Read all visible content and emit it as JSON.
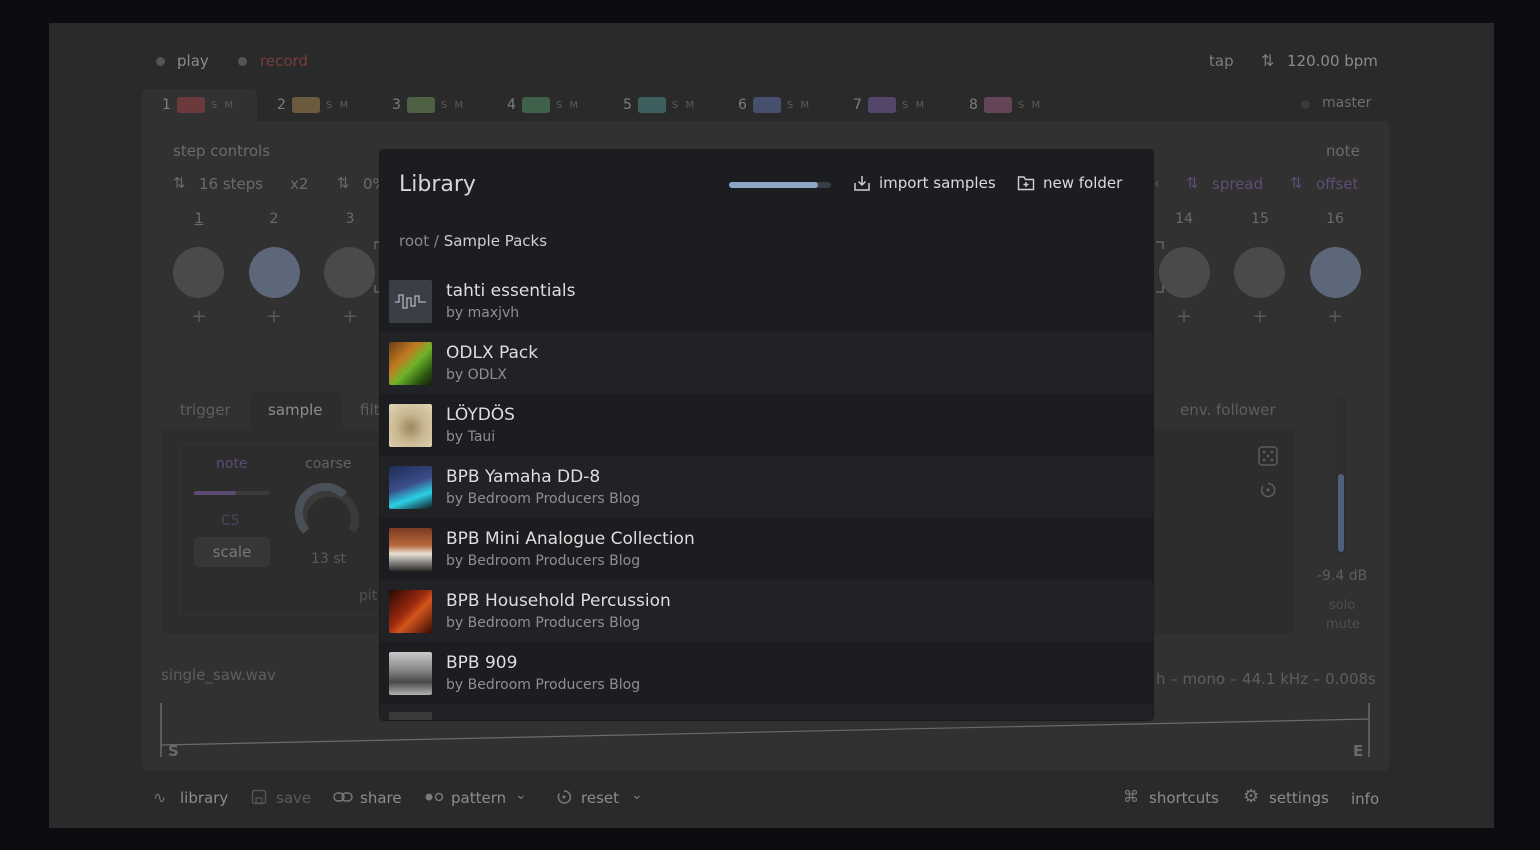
{
  "transport": {
    "play": "play",
    "record": "record",
    "tap": "tap",
    "bpm": "120.00 bpm"
  },
  "tracks": [
    {
      "num": "1",
      "color": "#6a3a3d"
    },
    {
      "num": "2",
      "color": "#6b5a3c"
    },
    {
      "num": "3",
      "color": "#4e6145"
    },
    {
      "num": "4",
      "color": "#3f6149"
    },
    {
      "num": "5",
      "color": "#3e5f60"
    },
    {
      "num": "6",
      "color": "#464f6d"
    },
    {
      "num": "7",
      "color": "#54466b"
    },
    {
      "num": "8",
      "color": "#634557"
    }
  ],
  "track_sm": "S M",
  "master": "master",
  "step_controls": {
    "label": "step controls",
    "steps": "16 steps",
    "mult": "x2",
    "pct": "0%",
    "note": "note",
    "spread": "spread",
    "offset": "offset"
  },
  "steps": {
    "left": [
      "1",
      "2",
      "3"
    ],
    "right": [
      "14",
      "15",
      "16"
    ]
  },
  "plus": "+",
  "subtabs": {
    "trigger": "trigger",
    "sample": "sample",
    "filter": "filt",
    "env": "env. follower"
  },
  "sample_panel": {
    "note": "note",
    "coarse": "coarse",
    "note_val": "C5",
    "scale": "scale",
    "st": "13 st",
    "pitch": "pit",
    "db": "-9.4 dB",
    "solo": "solo",
    "mute": "mute"
  },
  "file": {
    "name": "single_saw.wav",
    "info": "h – mono – 44.1 kHz – 0.008s",
    "start": "S",
    "end": "E"
  },
  "library": {
    "title": "Library",
    "progress": 0.87,
    "import": "import samples",
    "new_folder": "new folder",
    "crumb_root": "root",
    "crumb_sep": "/",
    "crumb_current": "Sample Packs",
    "items": [
      {
        "name": "tahti essentials",
        "author": "by maxjvh"
      },
      {
        "name": "ODLX Pack",
        "author": "by ODLX"
      },
      {
        "name": "LÖYDÖS",
        "author": "by Taui"
      },
      {
        "name": "BPB Yamaha DD-8",
        "author": "by Bedroom Producers Blog"
      },
      {
        "name": "BPB Mini Analogue Collection",
        "author": "by Bedroom Producers Blog"
      },
      {
        "name": "BPB Household Percussion",
        "author": "by Bedroom Producers Blog"
      },
      {
        "name": "BPB 909",
        "author": "by Bedroom Producers Blog"
      }
    ]
  },
  "bottom": {
    "library": "library",
    "save": "save",
    "share": "share",
    "pattern": "pattern",
    "reset": "reset",
    "shortcuts": "shortcuts",
    "settings": "settings",
    "info": "info"
  }
}
